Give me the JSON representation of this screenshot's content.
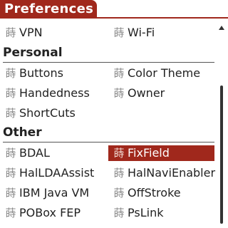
{
  "title": "Preferences",
  "accent_color": "#a0281c",
  "item_icon": "prefs-glyph-icon",
  "icon_glyph": "蒔",
  "rows": [
    {
      "left": "VPN",
      "right": "Wi-Fi"
    },
    {
      "section": "Personal"
    },
    {
      "left": "Buttons",
      "right": "Color Theme"
    },
    {
      "left": "Handedness",
      "right": "Owner"
    },
    {
      "left": "ShortCuts",
      "right": ""
    },
    {
      "section": "Other"
    },
    {
      "left": "BDAL",
      "right": "FixField",
      "selected": "right"
    },
    {
      "left": "HalLDAAssist",
      "right": "HalNaviEnabler"
    },
    {
      "left": "IBM Java VM",
      "right": "OffStroke"
    },
    {
      "left": "POBox FEP",
      "right": "PsLink"
    }
  ],
  "list": {
    "vpn": "VPN",
    "wifi": "Wi-Fi",
    "personal": "Personal",
    "buttons": "Buttons",
    "color_theme": "Color Theme",
    "handedness": "Handedness",
    "owner": "Owner",
    "shortcuts": "ShortCuts",
    "other": "Other",
    "bdal": "BDAL",
    "fixfield": "FixField",
    "halldaassist": "HalLDAAssist",
    "halnavienabler": "HalNaviEnabler",
    "ibm_java_vm": "IBM Java VM",
    "offstroke": "OffStroke",
    "pobox_fep": "POBox FEP",
    "pslink": "PsLink"
  },
  "selected_item": "FixField"
}
